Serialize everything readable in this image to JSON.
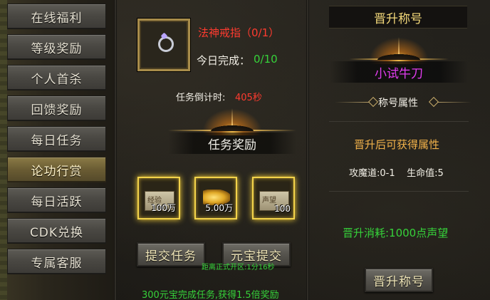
{
  "sidebar": {
    "items": [
      {
        "label": "在线福利",
        "active": false
      },
      {
        "label": "等级奖励",
        "active": false
      },
      {
        "label": "个人首杀",
        "active": false
      },
      {
        "label": "回馈奖励",
        "active": false
      },
      {
        "label": "每日任务",
        "active": false
      },
      {
        "label": "论功行赏",
        "active": true
      },
      {
        "label": "每日活跃",
        "active": false
      },
      {
        "label": "CDK兑换",
        "active": false
      },
      {
        "label": "专属客服",
        "active": false
      }
    ]
  },
  "task": {
    "item_name": "法神戒指（0/1）",
    "today_label": "今日完成：",
    "today_value": "0/10",
    "countdown_label": "任务倒计时:",
    "countdown_value": "405秒",
    "reward_title": "任务奖励",
    "rewards": [
      {
        "icon": "exp-scroll-icon",
        "label": "经验",
        "count": "100万"
      },
      {
        "icon": "gold-ingot-icon",
        "label": "元宝",
        "count": "5.00万"
      },
      {
        "icon": "reputation-scroll-icon",
        "label": "声望",
        "count": "100"
      }
    ],
    "submit_label": "提交任务",
    "ingot_submit_label": "元宝提交",
    "open_notice": "距离正式开区:1分16秒",
    "footer_notice": "300元宝完成任务,获得1.5倍奖励"
  },
  "title_panel": {
    "header": "晋升称号",
    "current_title": "小试牛刀",
    "attr_header": "称号属性",
    "gain_label": "晋升后可获得属性",
    "attrs": "攻魔道:0-1    生命值:5",
    "cost_label": "晋升消耗:1000点声望",
    "promote_label": "晋升称号"
  },
  "colors": {
    "accent_gold": "#f5c44a",
    "red": "#ff3b2f",
    "green": "#36d23a",
    "magenta": "#e23cf0"
  }
}
